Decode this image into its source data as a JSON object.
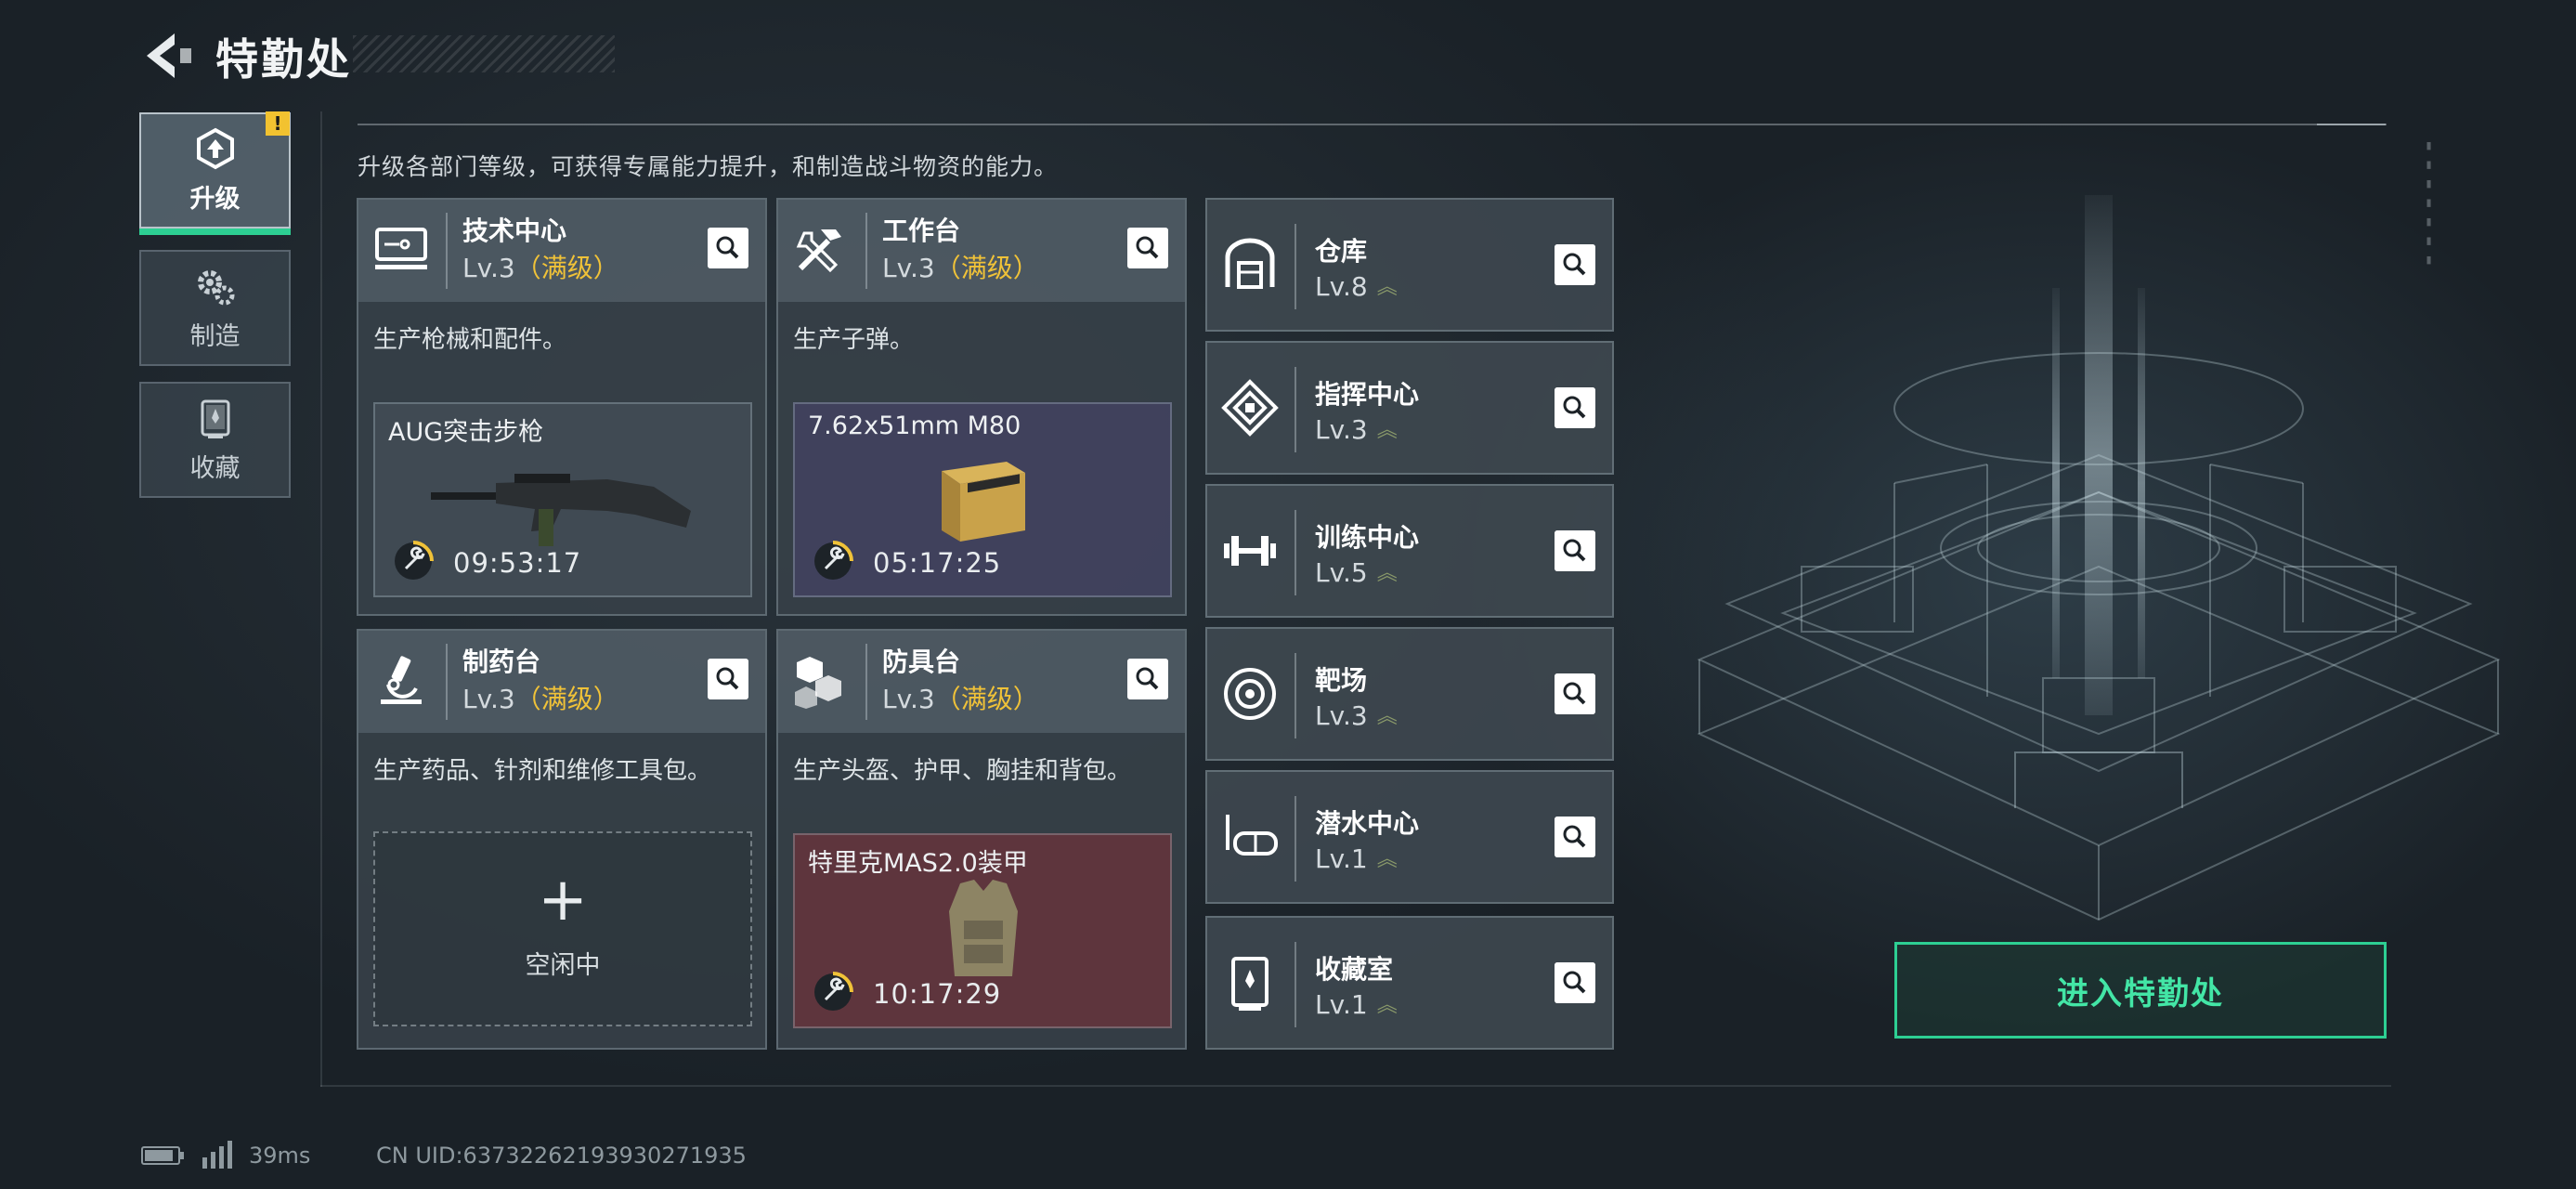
{
  "header": {
    "title": "特勤处"
  },
  "description": "升级各部门等级，可获得专属能力提升，和制造战斗物资的能力。",
  "alert_badge": "!",
  "tabs": [
    {
      "label": "升级",
      "icon": "upgrade-icon",
      "active": true
    },
    {
      "label": "制造",
      "icon": "gears-icon",
      "active": false
    },
    {
      "label": "收藏",
      "icon": "collection-icon",
      "active": false
    }
  ],
  "stations": [
    {
      "name": "技术中心",
      "level": "Lv.3",
      "max_tag": "（满级）",
      "icon": "monitor-icon",
      "desc": "生产枪械和配件。",
      "product": {
        "name": "AUG突击步枪",
        "timer": "09:53:17",
        "image": "rifle-image"
      }
    },
    {
      "name": "工作台",
      "level": "Lv.3",
      "max_tag": "（满级）",
      "icon": "tools-icon",
      "desc": "生产子弹。",
      "product": {
        "name": "7.62x51mm M80",
        "timer": "05:17:25",
        "image": "ammo-box-image"
      }
    },
    {
      "name": "制药台",
      "level": "Lv.3",
      "max_tag": "（满级）",
      "icon": "microscope-icon",
      "desc": "生产药品、针剂和维修工具包。",
      "idle": {
        "plus": "+",
        "label": "空闲中"
      }
    },
    {
      "name": "防具台",
      "level": "Lv.3",
      "max_tag": "（满级）",
      "icon": "boxes-icon",
      "desc": "生产头盔、护甲、胸挂和背包。",
      "product": {
        "name": "特里克MAS2.0装甲",
        "timer": "10:17:29",
        "image": "armor-vest-image"
      }
    }
  ],
  "facilities": [
    {
      "name": "仓库",
      "level": "Lv.8",
      "icon": "warehouse-icon"
    },
    {
      "name": "指挥中心",
      "level": "Lv.3",
      "icon": "command-icon"
    },
    {
      "name": "训练中心",
      "level": "Lv.5",
      "icon": "dumbbell-icon"
    },
    {
      "name": "靶场",
      "level": "Lv.3",
      "icon": "target-icon"
    },
    {
      "name": "潜水中心",
      "level": "Lv.1",
      "icon": "diving-mask-icon"
    },
    {
      "name": "收藏室",
      "level": "Lv.1",
      "icon": "trophy-case-icon"
    }
  ],
  "level_chevron": "︽",
  "enter_button": "进入特勤处",
  "status": {
    "ping": "39ms",
    "uid": "CN UID:63732262193930271935"
  },
  "colors": {
    "accent_green": "#2dcf93",
    "max_level_gold": "#f0c238",
    "alert_yellow": "#f2c230",
    "ammo_bg": "#424260",
    "armor_bg": "#66343c"
  }
}
